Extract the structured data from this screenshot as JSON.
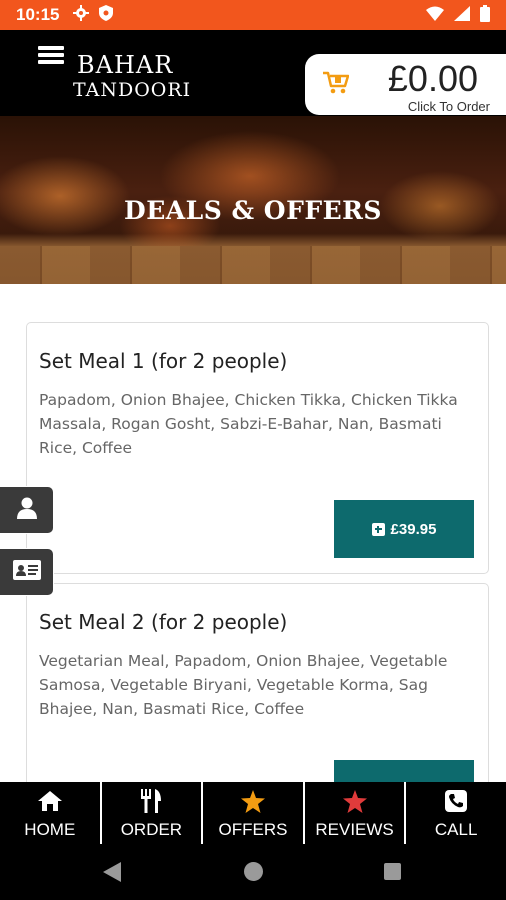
{
  "status_bar": {
    "time": "10:15"
  },
  "header": {
    "brand_line1": "BAHAR",
    "brand_line2": "TANDOORI",
    "cart_total": "£0.00",
    "cart_subtitle": "Click To Order"
  },
  "banner": {
    "title": "DEALS & OFFERS"
  },
  "deals": [
    {
      "title": "Set Meal 1 (for 2 people)",
      "description": "Papadom, Onion Bhajee, Chicken Tikka, Chicken Tikka Massala, Rogan Gosht, Sabzi-E-Bahar, Nan, Basmati Rice, Coffee",
      "price": "£39.95"
    },
    {
      "title": "Set Meal 2 (for 2 people)",
      "description": "Vegetarian Meal, Papadom, Onion Bhajee, Vegetable Samosa, Vegetable Biryani, Vegetable Korma, Sag Bhajee, Nan, Basmati Rice, Coffee",
      "price": ""
    }
  ],
  "bottom_nav": [
    {
      "label": "HOME",
      "icon": "home-icon"
    },
    {
      "label": "ORDER",
      "icon": "cutlery-icon"
    },
    {
      "label": "OFFERS",
      "icon": "star-icon"
    },
    {
      "label": "REVIEWS",
      "icon": "star-icon"
    },
    {
      "label": "CALL",
      "icon": "phone-icon"
    }
  ],
  "colors": {
    "status_bar": "#f2561d",
    "accent_teal": "#0d6a6d",
    "offers_star": "#f39c12",
    "reviews_star": "#e03b3b",
    "cart_icon": "#f39c12"
  }
}
